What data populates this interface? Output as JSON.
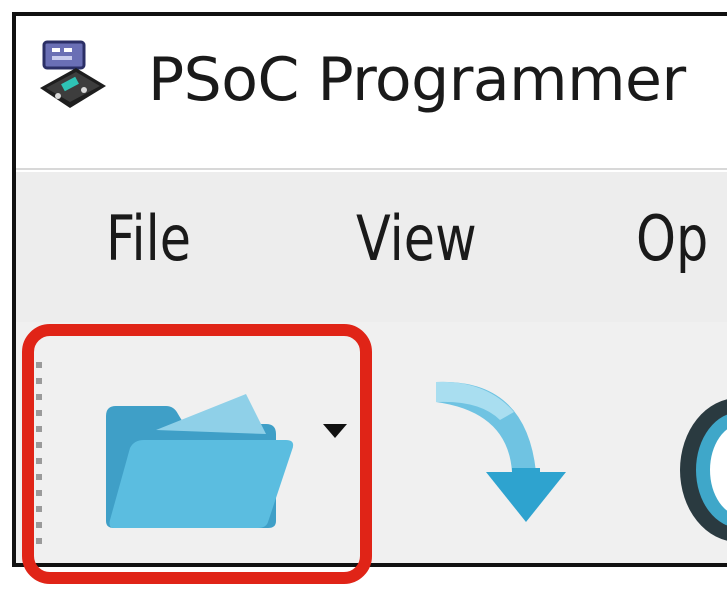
{
  "window": {
    "title": "PSoC Programmer"
  },
  "menubar": {
    "items": [
      "File",
      "View",
      "Op"
    ]
  },
  "toolbar": {
    "buttons": [
      {
        "name": "open-file",
        "icon": "folder-open-icon",
        "has_dropdown": true
      },
      {
        "name": "program",
        "icon": "download-arrow-icon"
      },
      {
        "name": "partial",
        "icon": "circle-icon"
      }
    ]
  },
  "colors": {
    "accent": "#4ab0d6",
    "highlight": "#e02417"
  }
}
